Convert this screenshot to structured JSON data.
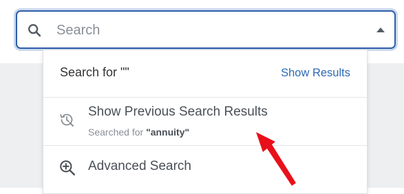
{
  "search": {
    "placeholder": "Search",
    "value": ""
  },
  "dropdown": {
    "search_for_label": "Search for \"\"",
    "show_results_label": "Show Results",
    "previous": {
      "title": "Show Previous Search Results",
      "subtitle_prefix": "Searched for ",
      "subtitle_term": "\"annuity\""
    },
    "advanced_label": "Advanced Search"
  },
  "icons": {
    "search": "search-icon",
    "caret": "caret-up-icon",
    "history": "history-icon",
    "advanced": "zoom-in-icon"
  },
  "colors": {
    "focus_border": "#2e5ea8",
    "link": "#2e6ab5",
    "annotation": "#e8101a"
  }
}
